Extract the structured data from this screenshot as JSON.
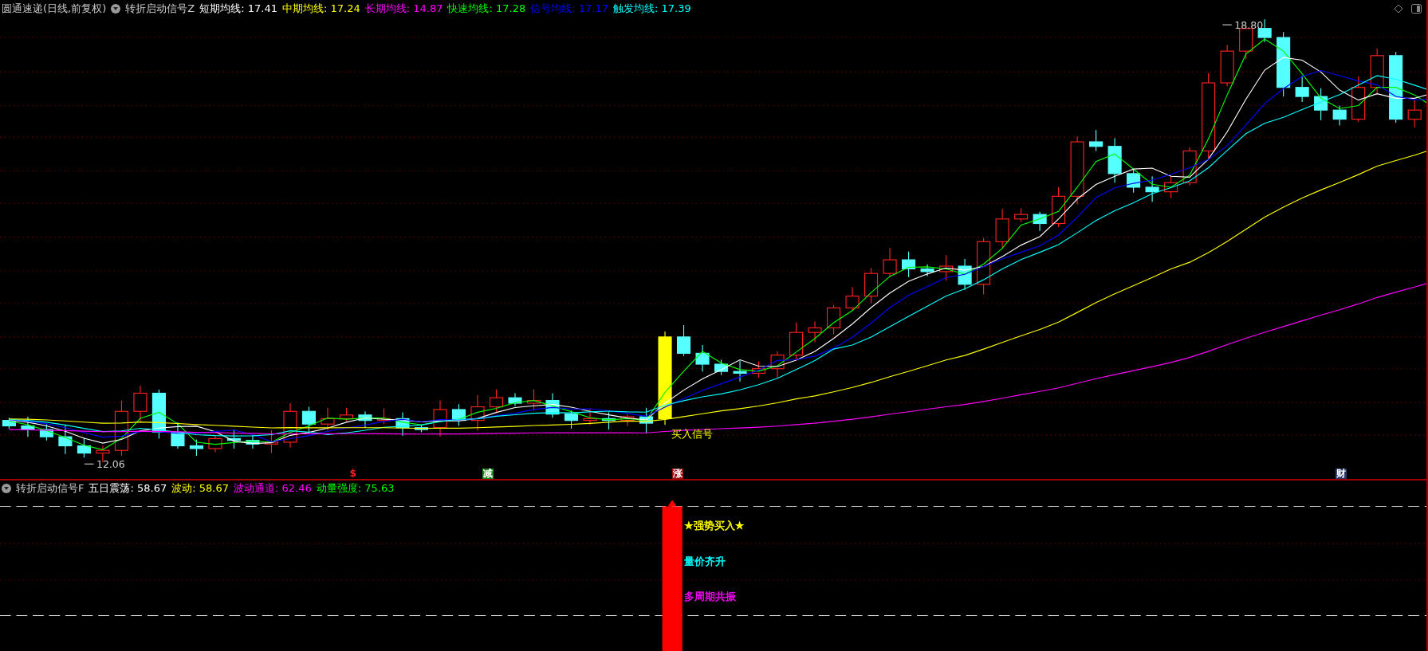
{
  "header": {
    "instrument": "圆通速递(日线,前复权)",
    "indicator": "转折启动信号Z",
    "lines": [
      {
        "label": "短期均线:",
        "value": "17.41",
        "color": "#ffffff"
      },
      {
        "label": "中期均线:",
        "value": "17.24",
        "color": "#ffff00"
      },
      {
        "label": "长期均线:",
        "value": "14.87",
        "color": "#ff00ff"
      },
      {
        "label": "快速均线:",
        "value": "17.28",
        "color": "#00ff00"
      },
      {
        "label": "信号均线:",
        "value": "17.17",
        "color": "#0000ff"
      },
      {
        "label": "触发均线:",
        "value": "17.39",
        "color": "#00ffff"
      }
    ]
  },
  "chart": {
    "high_label": "18.80",
    "low_label": "12.06",
    "signal_label": "买入信号"
  },
  "markers": [
    {
      "text": "$",
      "color": "#ff2020"
    },
    {
      "text": "减",
      "color": "#1a8a1a"
    },
    {
      "text": "涨",
      "color": "#a01010"
    },
    {
      "text": "财",
      "color": "#2a3a6a"
    }
  ],
  "lower_header": {
    "indicator": "转折启动信号F",
    "lines": [
      {
        "label": "五日震荡:",
        "value": "58.67",
        "color": "#ffffff"
      },
      {
        "label": "波动:",
        "value": "58.67",
        "color": "#ffff00"
      },
      {
        "label": "波动通道:",
        "value": "62.46",
        "color": "#ff00ff"
      },
      {
        "label": "动量强度:",
        "value": "75.63",
        "color": "#00ff00"
      }
    ]
  },
  "signals": [
    {
      "text": "★强势买入★",
      "color": "#ffff00"
    },
    {
      "text": "量价齐升",
      "color": "#00ffff"
    },
    {
      "text": "多周期共振",
      "color": "#ff00ff"
    }
  ]
}
